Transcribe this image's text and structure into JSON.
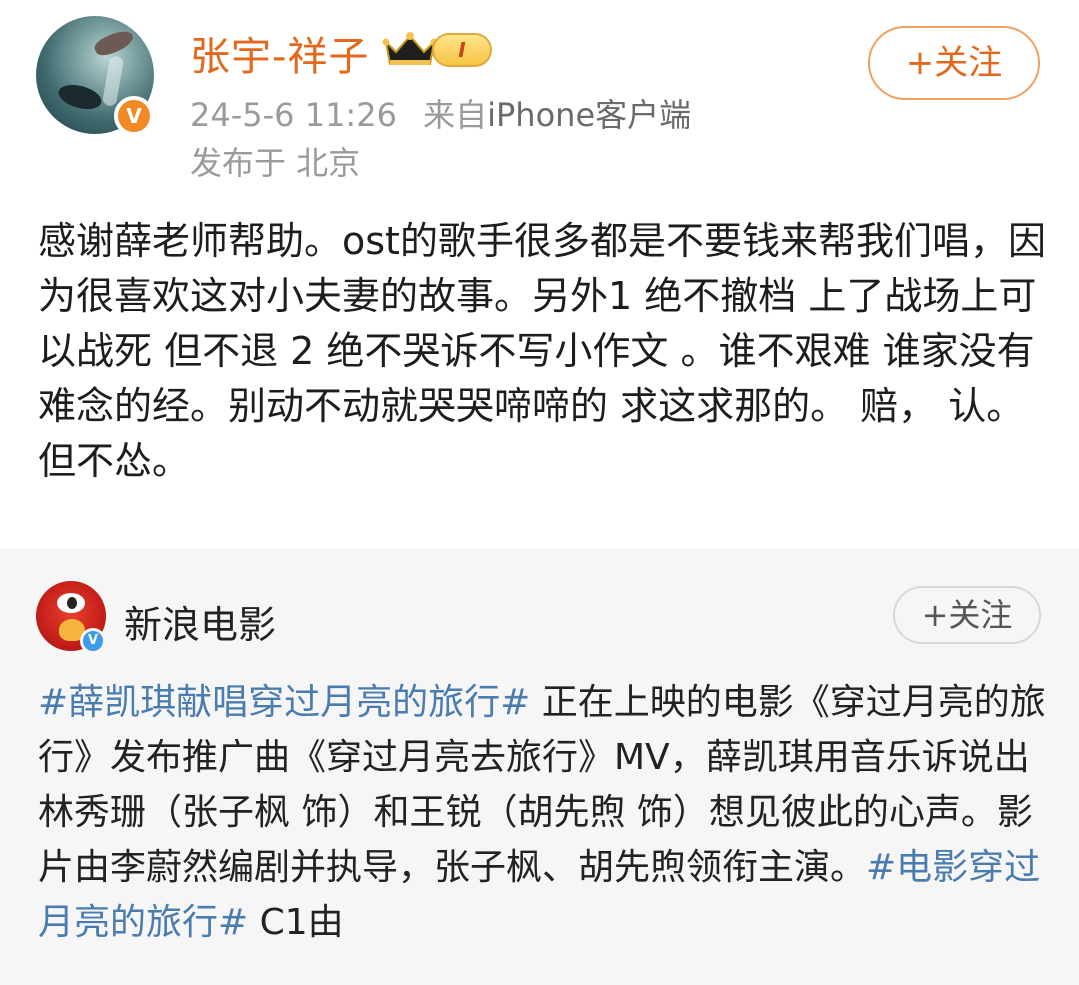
{
  "post": {
    "username": "张宇-祥子",
    "level_badge": "I",
    "timestamp": "24-5-6 11:26",
    "source_prefix": "来自",
    "source_client": "iPhone客户端",
    "location": "发布于 北京",
    "follow_label": "+关注",
    "verified_icon": "v-verified-icon",
    "body": "感谢薛老师帮助。ost的歌手很多都是不要钱来帮我们唱，因为很喜欢这对小夫妻的故事。另外1 绝不撤档 上了战场上可以战死 但不退 2  绝不哭诉不写小作文 。谁不艰难 谁家没有难念的经。别动不动就哭哭啼啼的 求这求那的。 赔， 认。但不怂。"
  },
  "repost": {
    "username": "新浪电影",
    "follow_label": "+关注",
    "hashtag1": "#薛凯琪献唱穿过月亮的旅行#",
    "text_mid": " 正在上映的电影《穿过月亮的旅行》发布推广曲《穿过月亮去旅行》MV，薛凯琪用音乐诉说出林秀珊（张子枫 饰）和王锐（胡先煦 饰）想见彼此的心声。影片由李蔚然编剧并执导，张子枫、胡先煦领衔主演。",
    "hashtag2": "#电影穿过月亮的旅行#",
    "text_tail": " C1由"
  },
  "colors": {
    "username_orange": "#e2681d",
    "hashtag_blue": "#4a7cb0",
    "meta_gray": "#9a9a9a",
    "repost_bg": "#f6f6f6"
  }
}
